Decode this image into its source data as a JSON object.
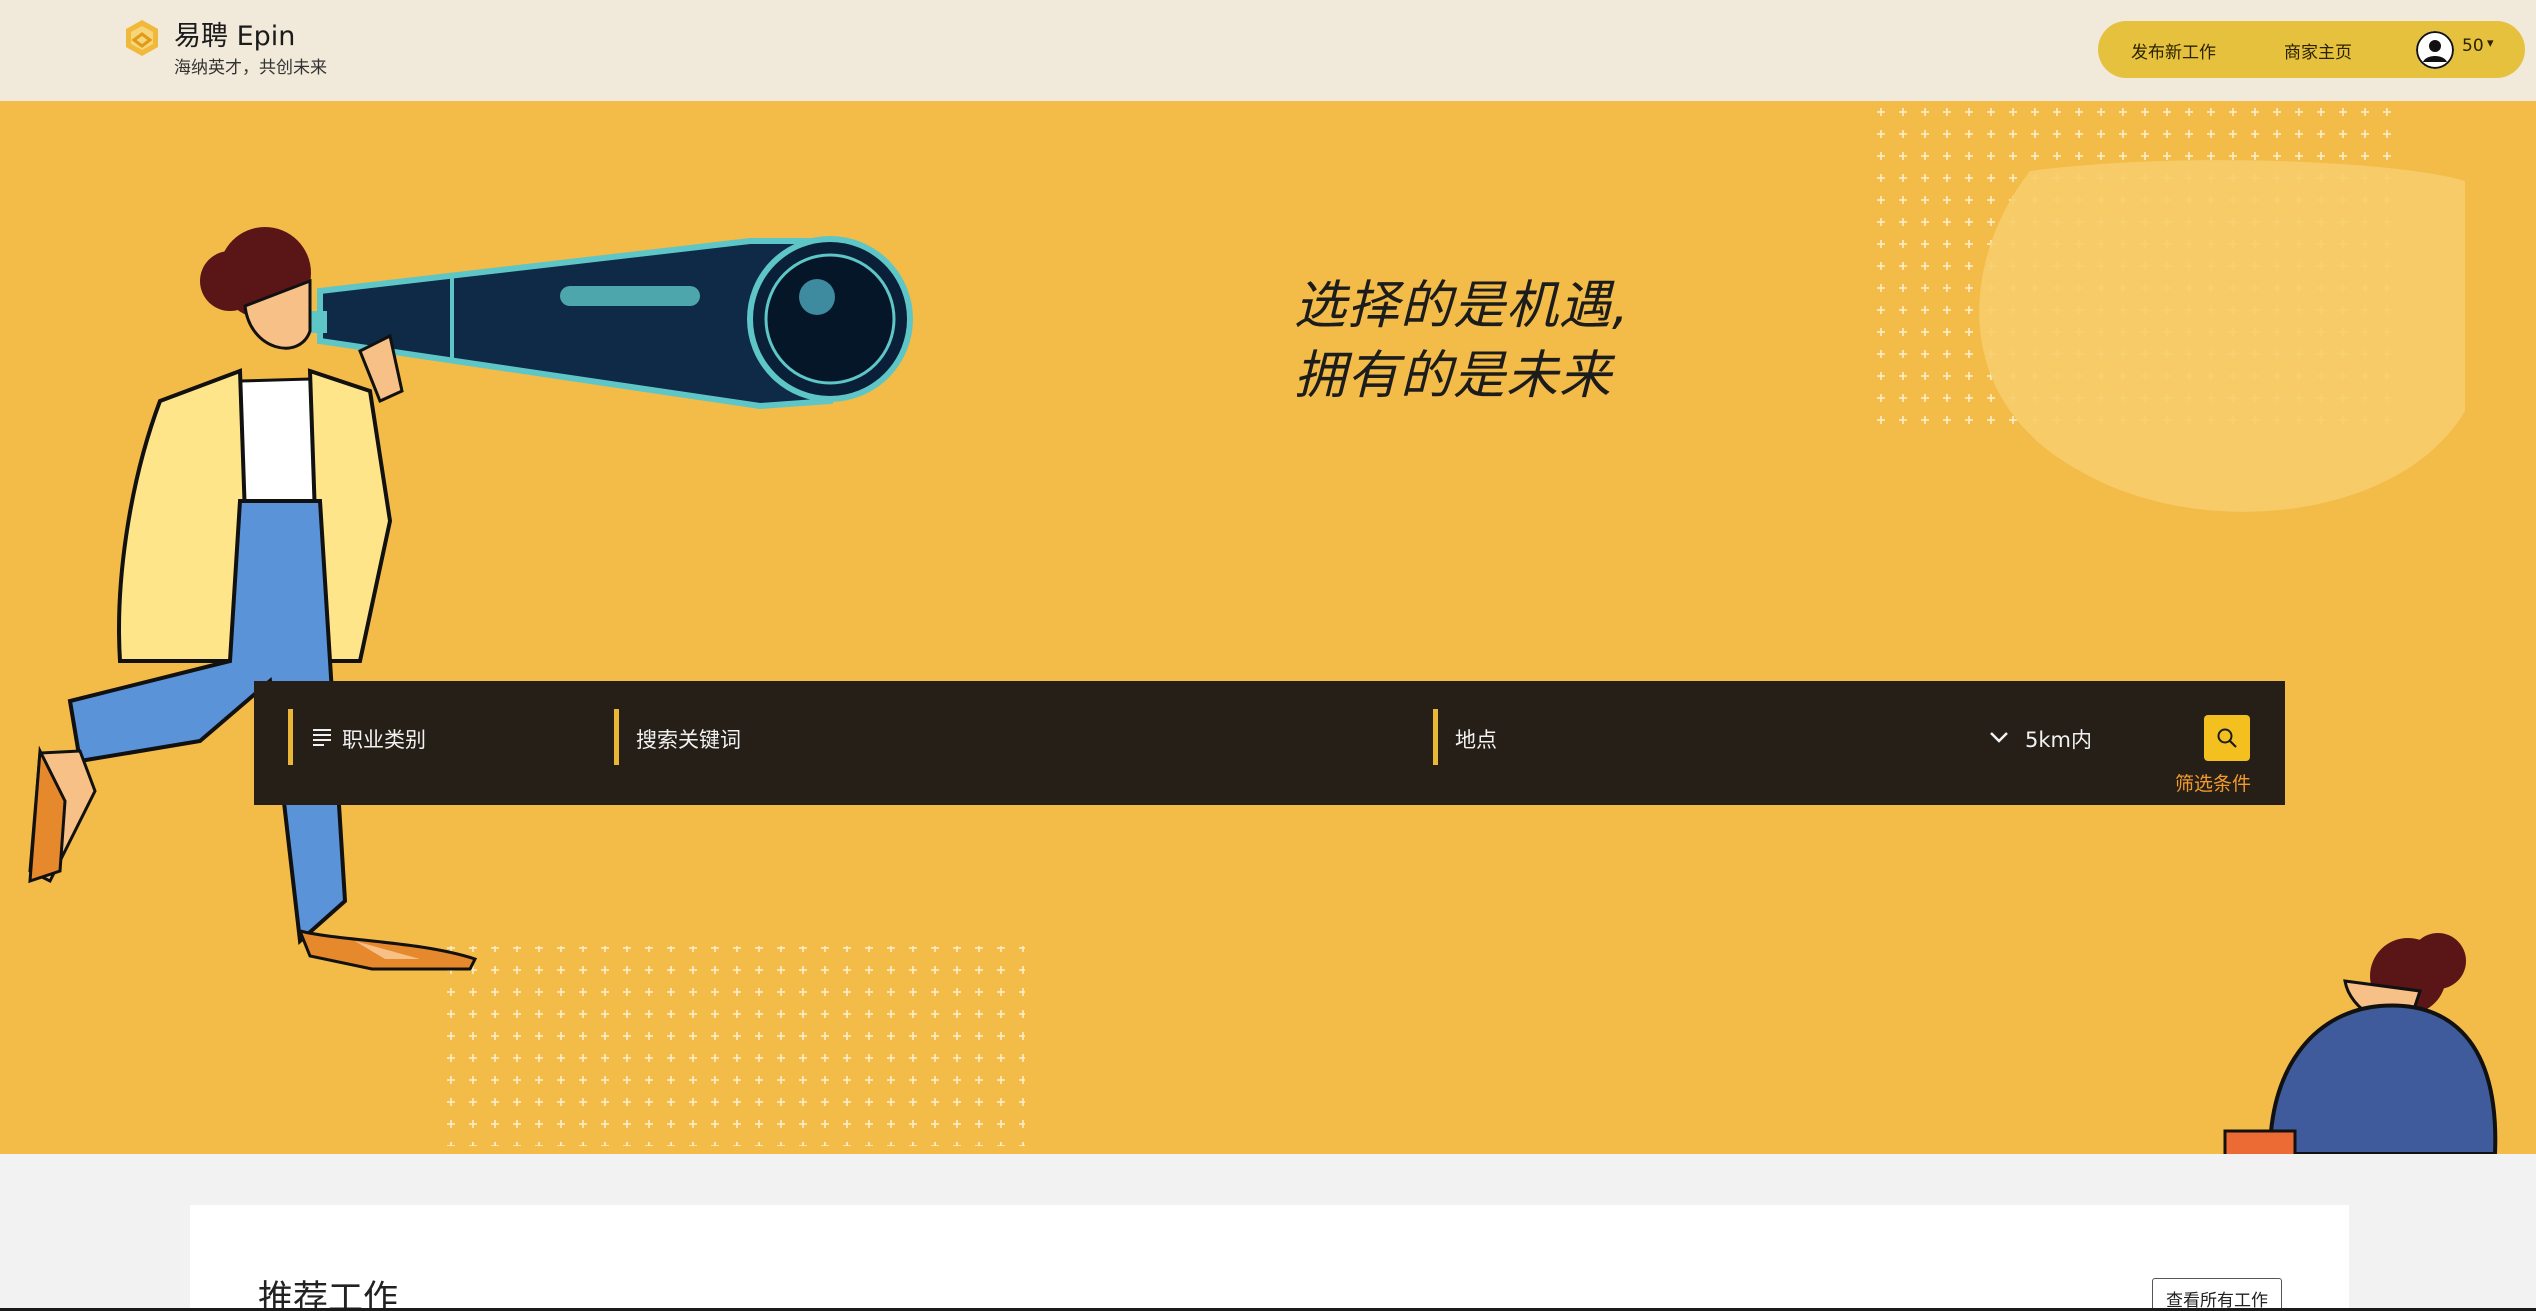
{
  "header": {
    "brand_name": "易聘 Epin",
    "slogan": "海纳英才，共创未来",
    "nav": {
      "post_job": "发布新工作",
      "merchant_home": "商家主页",
      "user_count": "50"
    },
    "logo_icon": "epin-hexagon-logo-icon",
    "avatar_icon": "user-avatar-icon"
  },
  "hero": {
    "tagline_line1": "选择的是机遇,",
    "tagline_line2": "拥有的是未来",
    "search": {
      "category_label": "职业类别",
      "keyword_placeholder": "搜索关键词",
      "location_placeholder": "地点",
      "distance_value": "5km内",
      "filter_link": "筛选条件"
    }
  },
  "recommended": {
    "title": "推荐工作",
    "view_all": "查看所有工作"
  },
  "colors": {
    "header_bg": "#f1e9da",
    "hero_bg": "#f3bb48",
    "nav_pill": "#e6c13e",
    "search_bar": "#251f17",
    "accent": "#f4c020",
    "filter_orange": "#f39a2d"
  }
}
